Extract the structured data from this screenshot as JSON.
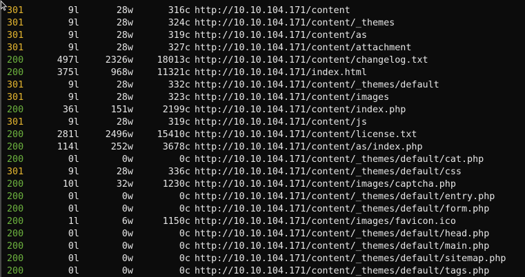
{
  "colors": {
    "background": "#0c0c0c",
    "text": "#e6e6e6",
    "status_301": "#e4b52f",
    "status_200": "#6db33f"
  },
  "cursor": {
    "icon": "mouse-pointer-icon"
  },
  "rows": [
    {
      "status": "301",
      "lines": "9l",
      "words": "28w",
      "chars": "316c",
      "url": "http://10.10.104.171/content"
    },
    {
      "status": "301",
      "lines": "9l",
      "words": "28w",
      "chars": "324c",
      "url": "http://10.10.104.171/content/_themes"
    },
    {
      "status": "301",
      "lines": "9l",
      "words": "28w",
      "chars": "319c",
      "url": "http://10.10.104.171/content/as"
    },
    {
      "status": "301",
      "lines": "9l",
      "words": "28w",
      "chars": "327c",
      "url": "http://10.10.104.171/content/attachment"
    },
    {
      "status": "200",
      "lines": "497l",
      "words": "2326w",
      "chars": "18013c",
      "url": "http://10.10.104.171/content/changelog.txt"
    },
    {
      "status": "200",
      "lines": "375l",
      "words": "968w",
      "chars": "11321c",
      "url": "http://10.10.104.171/index.html"
    },
    {
      "status": "301",
      "lines": "9l",
      "words": "28w",
      "chars": "332c",
      "url": "http://10.10.104.171/content/_themes/default"
    },
    {
      "status": "301",
      "lines": "9l",
      "words": "28w",
      "chars": "323c",
      "url": "http://10.10.104.171/content/images"
    },
    {
      "status": "200",
      "lines": "36l",
      "words": "151w",
      "chars": "2199c",
      "url": "http://10.10.104.171/content/index.php"
    },
    {
      "status": "301",
      "lines": "9l",
      "words": "28w",
      "chars": "319c",
      "url": "http://10.10.104.171/content/js"
    },
    {
      "status": "200",
      "lines": "281l",
      "words": "2496w",
      "chars": "15410c",
      "url": "http://10.10.104.171/content/license.txt"
    },
    {
      "status": "200",
      "lines": "114l",
      "words": "252w",
      "chars": "3678c",
      "url": "http://10.10.104.171/content/as/index.php"
    },
    {
      "status": "200",
      "lines": "0l",
      "words": "0w",
      "chars": "0c",
      "url": "http://10.10.104.171/content/_themes/default/cat.php"
    },
    {
      "status": "301",
      "lines": "9l",
      "words": "28w",
      "chars": "336c",
      "url": "http://10.10.104.171/content/_themes/default/css"
    },
    {
      "status": "200",
      "lines": "10l",
      "words": "32w",
      "chars": "1230c",
      "url": "http://10.10.104.171/content/images/captcha.php"
    },
    {
      "status": "200",
      "lines": "0l",
      "words": "0w",
      "chars": "0c",
      "url": "http://10.10.104.171/content/_themes/default/entry.php"
    },
    {
      "status": "200",
      "lines": "0l",
      "words": "0w",
      "chars": "0c",
      "url": "http://10.10.104.171/content/_themes/default/form.php"
    },
    {
      "status": "200",
      "lines": "1l",
      "words": "6w",
      "chars": "1150c",
      "url": "http://10.10.104.171/content/images/favicon.ico"
    },
    {
      "status": "200",
      "lines": "0l",
      "words": "0w",
      "chars": "0c",
      "url": "http://10.10.104.171/content/_themes/default/head.php"
    },
    {
      "status": "200",
      "lines": "0l",
      "words": "0w",
      "chars": "0c",
      "url": "http://10.10.104.171/content/_themes/default/main.php"
    },
    {
      "status": "200",
      "lines": "0l",
      "words": "0w",
      "chars": "0c",
      "url": "http://10.10.104.171/content/_themes/default/sitemap.php"
    },
    {
      "status": "200",
      "lines": "0l",
      "words": "0w",
      "chars": "0c",
      "url": "http://10.10.104.171/content/_themes/default/tags.php"
    }
  ]
}
